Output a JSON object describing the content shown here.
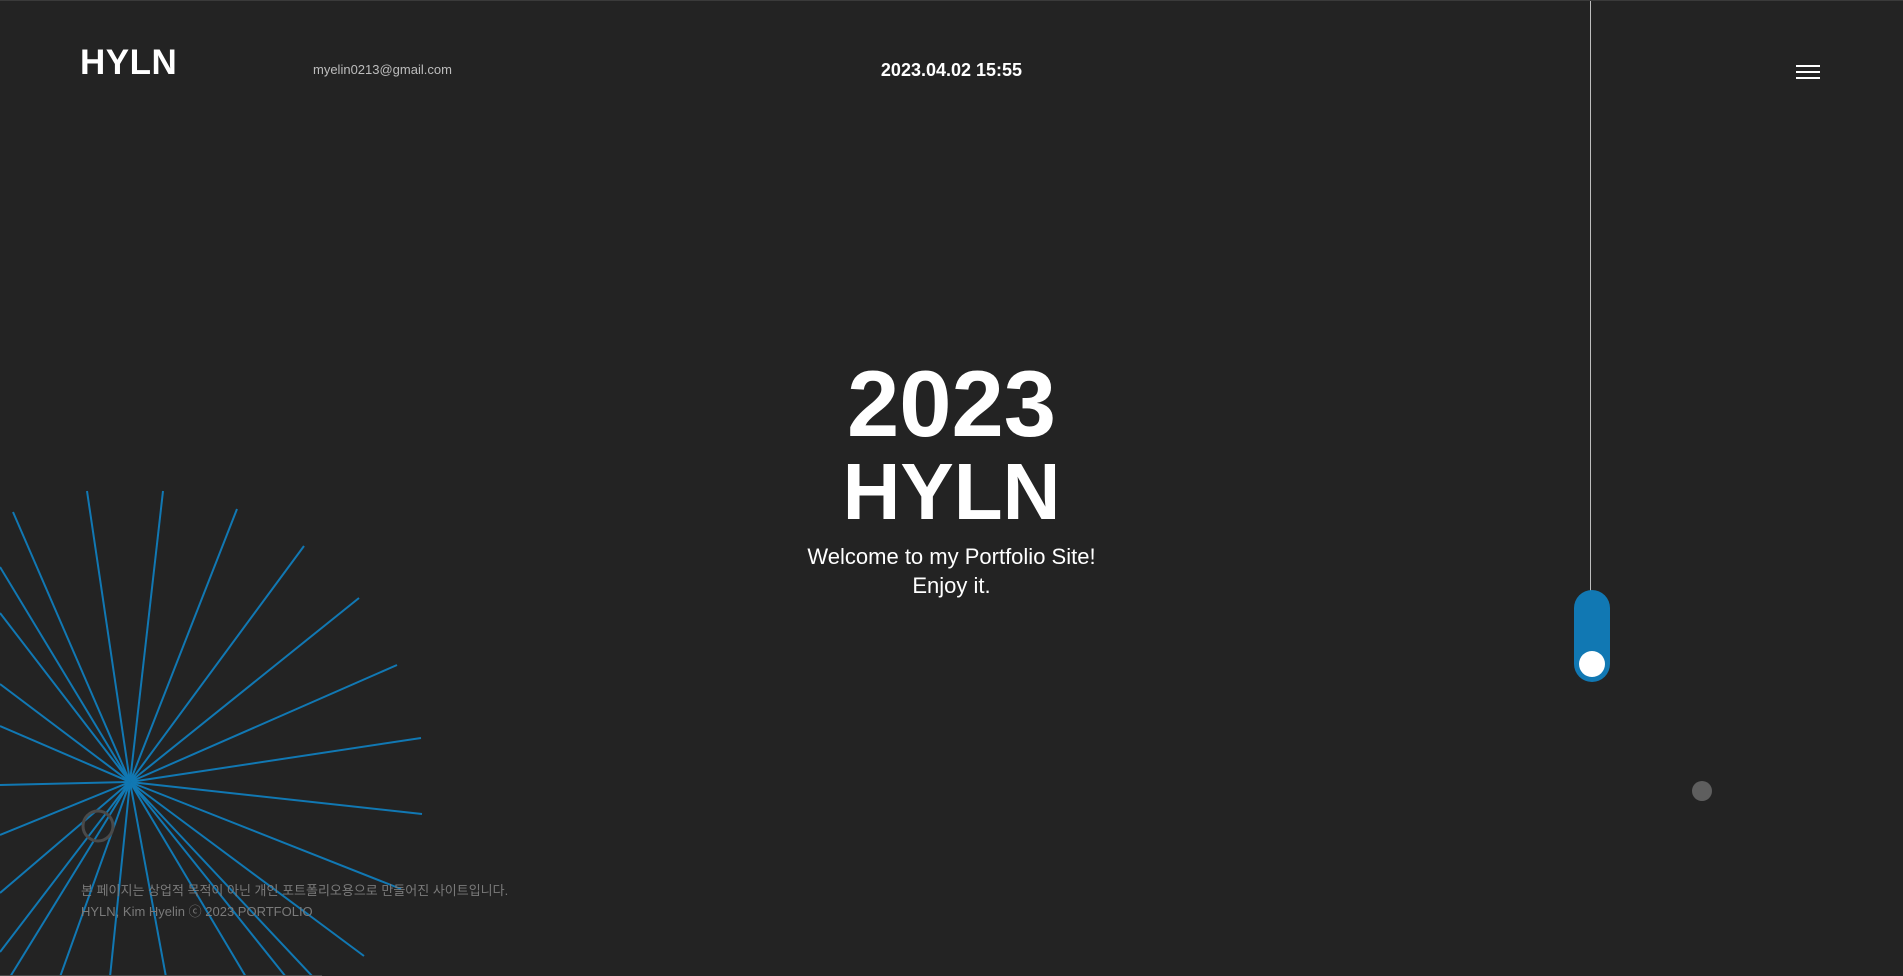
{
  "header": {
    "logo": "HYLN",
    "email": "myelin0213@gmail.com",
    "datetime": "2023.04.02 15:55"
  },
  "hero": {
    "year": "2023",
    "name": "HYLN",
    "line1": "Welcome to my Portfolio Site!",
    "line2": "Enjoy it."
  },
  "footer": {
    "notice": "본 페이지는 상업적 목적이 아닌 개인 포트폴리오용으로 만들어진 사이트입니다.",
    "copyright": "HYLN, Kim Hyelin ⓒ 2023 PORTFOLIO"
  },
  "colors": {
    "background": "#232323",
    "accent": "#1178b3",
    "text": "#ffffff",
    "muted": "#7a7a7a"
  },
  "icons": {
    "menu": "hamburger-menu-icon",
    "decoration": "radial-line-burst"
  }
}
